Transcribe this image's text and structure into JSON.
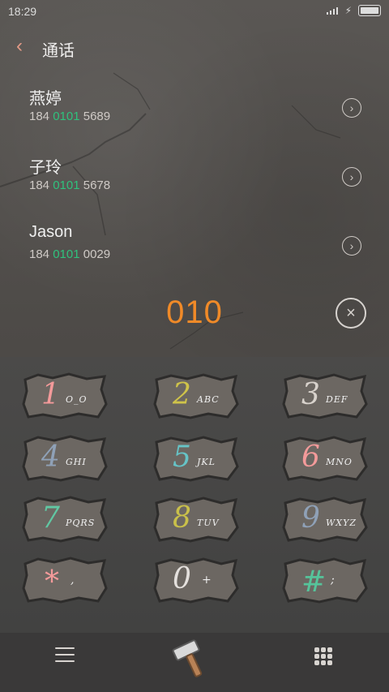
{
  "status": {
    "time": "18:29"
  },
  "header": {
    "title": "通话"
  },
  "contacts": [
    {
      "name": "燕婷",
      "num_prefix": "184 ",
      "num_match": "0101",
      "num_suffix": " 5689"
    },
    {
      "name": "子玲",
      "num_prefix": "184 ",
      "num_match": "0101",
      "num_suffix": " 5678"
    },
    {
      "name": "Jason",
      "num_prefix": "184 ",
      "num_match": "0101",
      "num_suffix": " 0029"
    }
  ],
  "entry": {
    "value": "010"
  },
  "keypad": [
    {
      "digit": "1",
      "letters": "O_O",
      "color": "#f39a9a"
    },
    {
      "digit": "2",
      "letters": "ABC",
      "color": "#cfc34a"
    },
    {
      "digit": "3",
      "letters": "DEF",
      "color": "#d8d2cc"
    },
    {
      "digit": "4",
      "letters": "GHI",
      "color": "#8fa1b7"
    },
    {
      "digit": "5",
      "letters": "JKL",
      "color": "#66c3c6"
    },
    {
      "digit": "6",
      "letters": "MNO",
      "color": "#f39a9a"
    },
    {
      "digit": "7",
      "letters": "PQRS",
      "color": "#61c7a3"
    },
    {
      "digit": "8",
      "letters": "TUV",
      "color": "#c9c04a"
    },
    {
      "digit": "9",
      "letters": "WXYZ",
      "color": "#8fa1b7"
    },
    {
      "digit": "*",
      "letters": ",",
      "color": "#f39a9a"
    },
    {
      "digit": "0",
      "letters": "+",
      "color": "#e4e0dd"
    },
    {
      "digit": "#",
      "letters": ";",
      "color": "#56c39a"
    }
  ],
  "colors": {
    "accent": "#f08a28",
    "match": "#2fc27d",
    "back": "#e39a86"
  },
  "icons": [
    "back-chevron-icon",
    "chevron-right-icon",
    "clear-icon",
    "menu-icon",
    "hammer-icon",
    "dialpad-icon"
  ]
}
